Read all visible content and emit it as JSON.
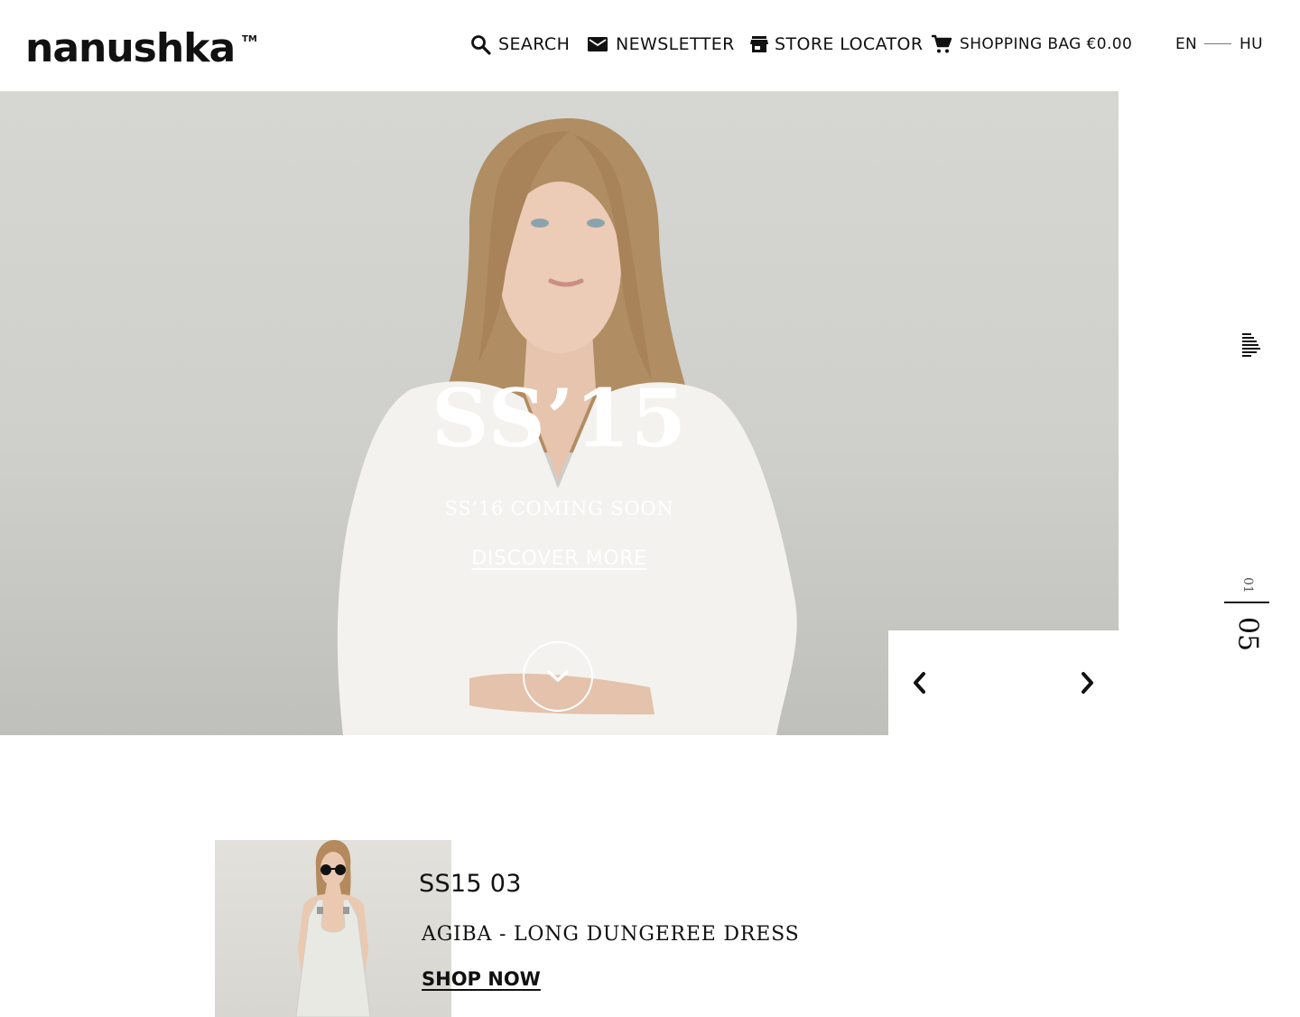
{
  "brand": {
    "logo_text": "nanushka",
    "trademark": "TM"
  },
  "header": {
    "search_label": "SEARCH",
    "newsletter_label": "NEWSLETTER",
    "store_locator_label": "STORE LOCATOR",
    "shopping_bag_label": "SHOPPING BAG €0.00",
    "languages": [
      "EN",
      "HU"
    ]
  },
  "hero": {
    "title": "SS’15",
    "subtitle": "SS’16 COMING SOON",
    "cta": "DISCOVER MORE"
  },
  "slider": {
    "current": "01",
    "total": "05"
  },
  "product": {
    "code": "SS15 03",
    "name": "AGIBA - LONG DUNGEREE DRESS",
    "cta": "SHOP NOW"
  },
  "icons": {
    "search": "search-icon",
    "newsletter": "envelope-icon",
    "store": "store-icon",
    "bag": "cart-icon",
    "menu": "menu-icon",
    "scroll": "chevron-down-icon",
    "prev": "chevron-left-icon",
    "next": "chevron-right-icon"
  },
  "colors": {
    "text": "#111111",
    "hero_text": "#ffffff",
    "background": "#ffffff"
  }
}
